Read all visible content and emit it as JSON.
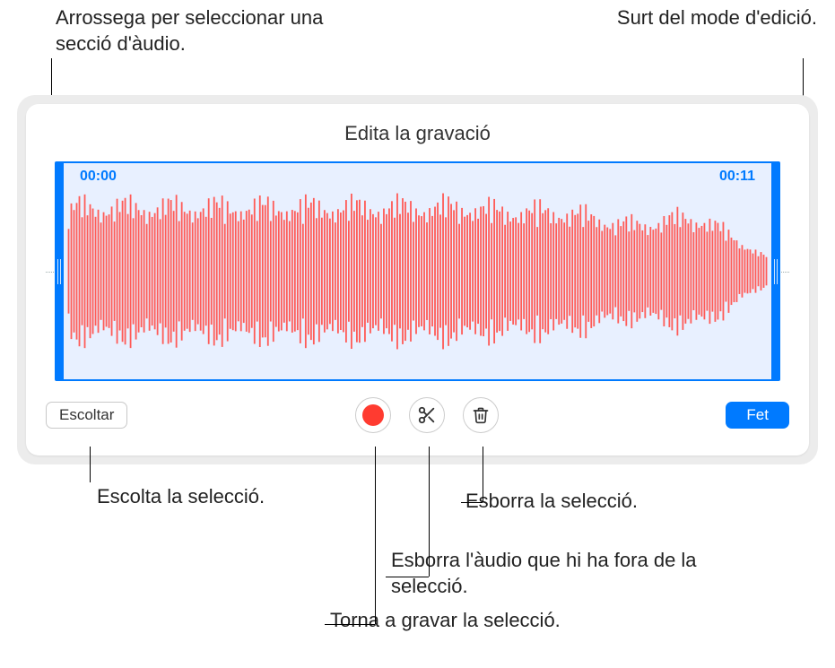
{
  "callouts": {
    "dragToSelect": "Arrossega per seleccionar una secció d'àudio.",
    "exitEdit": "Surt del mode d'edició.",
    "listenSelection": "Escolta la selecció.",
    "rerecordSelection": "Torna a gravar la selecció.",
    "trimOutside": "Esborra l'àudio que hi ha fora de la selecció.",
    "deleteSelection": "Esborra la selecció."
  },
  "editor": {
    "title": "Edita la gravació",
    "listenLabel": "Escoltar",
    "doneLabel": "Fet",
    "selection": {
      "start": "00:00",
      "end": "00:11"
    },
    "icons": {
      "record": "record-icon",
      "trim": "scissors-icon",
      "delete": "trash-icon"
    }
  }
}
